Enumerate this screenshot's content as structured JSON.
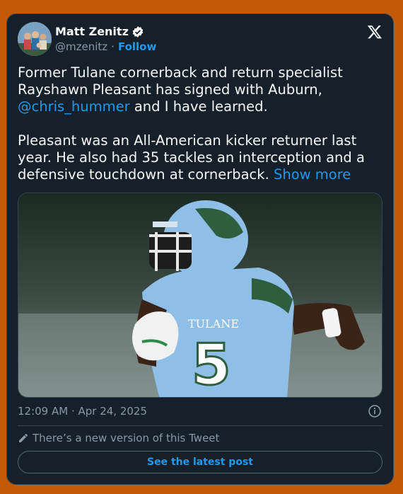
{
  "author": {
    "name": "Matt Zenitz",
    "handle": "@mzenitz",
    "separator": "·",
    "follow_label": "Follow",
    "verified_icon": "verified-badge-icon"
  },
  "tweet": {
    "line1": "Former Tulane cornerback and return specialist Rayshawn Pleasant has signed with Auburn, ",
    "mention": "@chris_hummer",
    "line2": " and I have learned.\n\nPleasant was an All-American kicker returner last year. He also had 35 tackles an interception and a defensive touchdown at cornerback. ",
    "show_more": "Show more"
  },
  "meta": {
    "timestamp": "12:09 AM · Apr 24, 2025"
  },
  "footer": {
    "new_version_text": "There’s a new version of this Tweet",
    "see_latest_label": "See the latest post"
  },
  "colors": {
    "background": "#c25a06",
    "card": "#15202b",
    "accent": "#1d9bf0",
    "text": "#f7f9f9",
    "muted": "#8b98a5"
  }
}
